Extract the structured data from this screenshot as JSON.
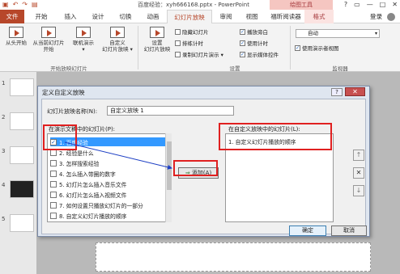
{
  "window": {
    "title": "百度经验：xyh666168.pptx - PowerPoint",
    "context_title": "绘图工具",
    "qat_icons": [
      "save-icon",
      "undo-icon",
      "redo-icon",
      "start-slideshow-icon"
    ],
    "controls": [
      "?",
      "▭",
      "—",
      "□",
      "✕"
    ]
  },
  "tabs": [
    "文件",
    "开始",
    "插入",
    "设计",
    "切换",
    "动画",
    "幻灯片放映",
    "审阅",
    "视图",
    "福昕阅读器",
    "格式"
  ],
  "active_tab": "幻灯片放映",
  "login": "登录",
  "ribbon": {
    "buttons": [
      "从头开始",
      "从当前幻灯片\n开始",
      "联机演示\n▾",
      "自定义\n幻灯片放映 ▾",
      "设置\n幻灯片放映"
    ],
    "group_start": "开始放映幻灯片",
    "setup_checks": [
      {
        "label": "隐藏幻灯片",
        "checked": false
      },
      {
        "label": "排练计时",
        "checked": false
      },
      {
        "label": "录制幻灯片演示 ▾",
        "checked": false
      },
      {
        "label": "播放旁白",
        "checked": true
      },
      {
        "label": "使用计时",
        "checked": true
      },
      {
        "label": "显示媒体控件",
        "checked": true
      }
    ],
    "group_setup": "设置",
    "monitor_value": "自动",
    "presenter_view": "使用演示者视图",
    "group_monitor": "监视器"
  },
  "thumbnails": [
    "1",
    "2",
    "3",
    "4",
    "5"
  ],
  "dialog": {
    "title": "定义自定义放映",
    "help": "?",
    "close": "✕",
    "name_label": "幻灯片放映名称(N):",
    "name_value": "自定义放映 1",
    "left_caption": "在演示文稿中的幻灯片(P):",
    "slides": [
      {
        "label": "1. 百度经验",
        "checked": true
      },
      {
        "label": "2. 经验是什么",
        "checked": false
      },
      {
        "label": "3. 怎样搜索经验",
        "checked": false
      },
      {
        "label": "4. 怎么插入带圈的数字",
        "checked": false
      },
      {
        "label": "5. 幻灯片怎么插入音乐文件",
        "checked": false
      },
      {
        "label": "6. 幻灯片怎么插入视频文件",
        "checked": false
      },
      {
        "label": "7. 如何设置只播放幻灯片的一部分",
        "checked": false
      },
      {
        "label": "8. 自定义幻灯片播放的顺序",
        "checked": false
      }
    ],
    "add_button": "添加(A)",
    "right_caption": "在自定义放映中的幻灯片(L):",
    "custom_slides": [
      "1. 自定义幻灯片播放的顺序"
    ],
    "side_buttons": [
      "↑",
      "✕",
      "↓"
    ],
    "ok_button": "确定",
    "cancel_button": "取消"
  },
  "colors": {
    "accent": "#b7472a",
    "highlight": "#e02020",
    "selection": "#3399ff"
  }
}
